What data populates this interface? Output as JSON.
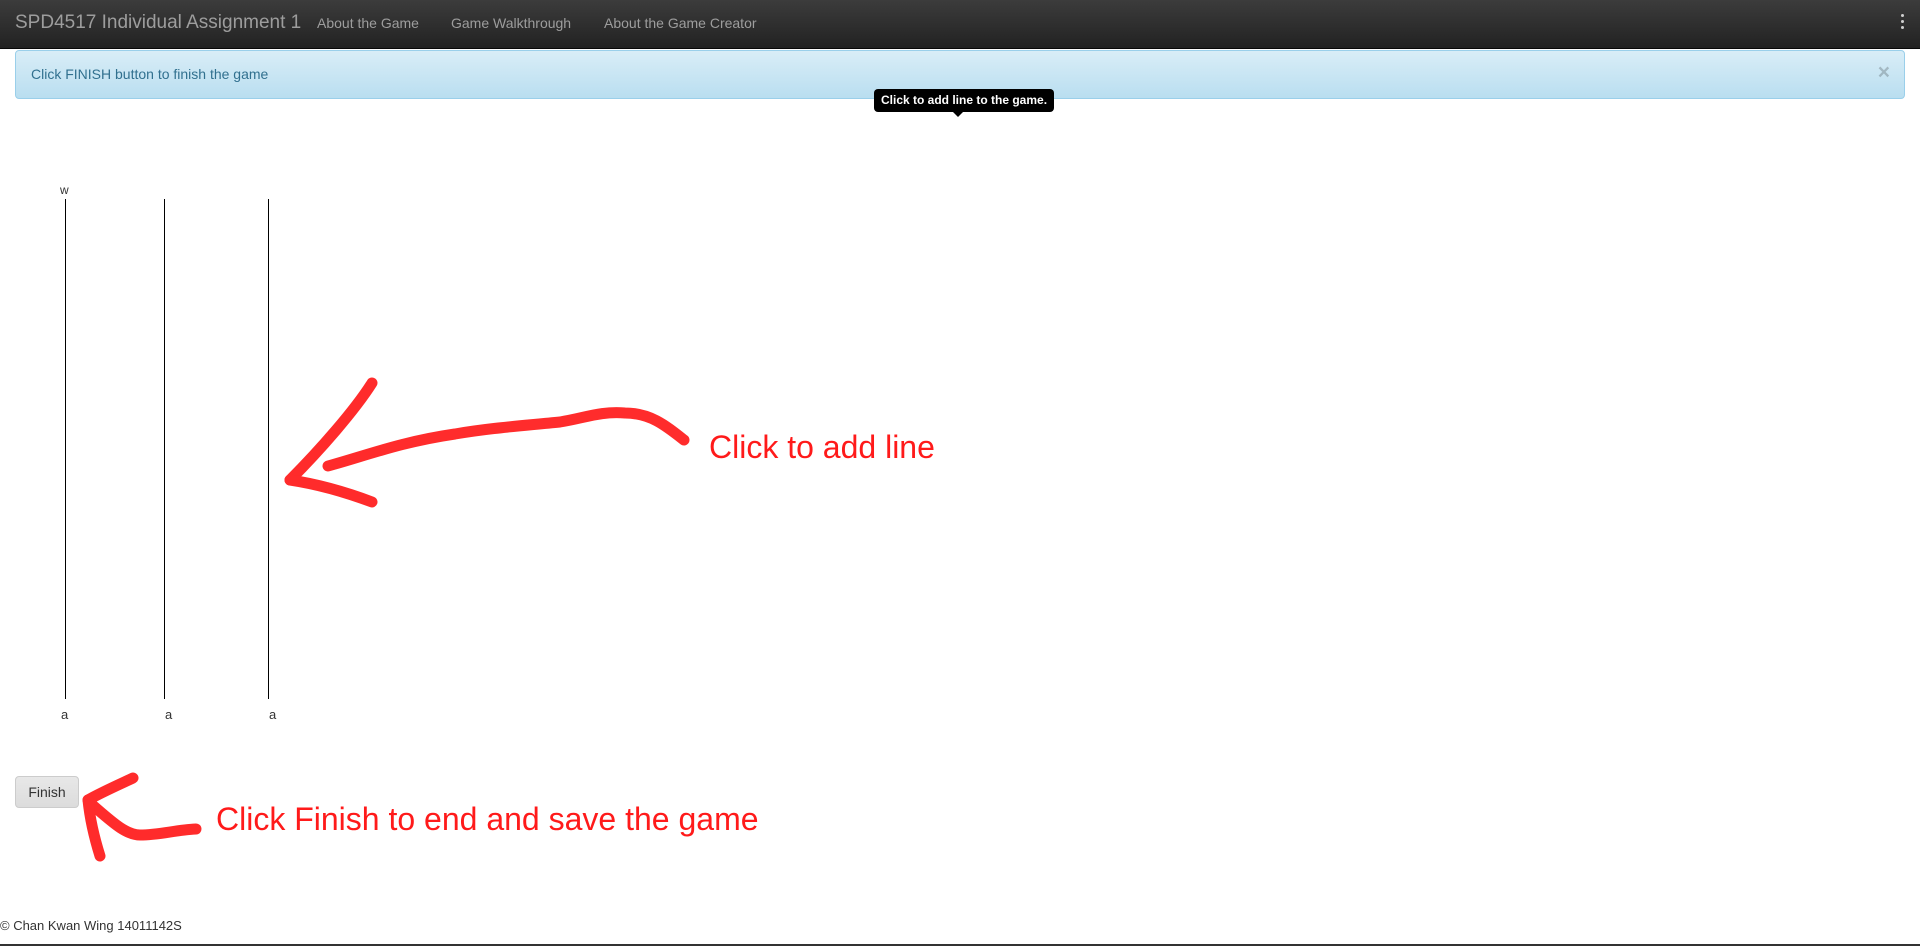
{
  "navbar": {
    "brand": "SPD4517 Individual Assignment 1",
    "links": [
      "About the Game",
      "Game Walkthrough",
      "About the Game Creator"
    ],
    "menu_icon": "kebab-menu-icon"
  },
  "alert": {
    "text": "Click FINISH button to finish the game",
    "close": "×"
  },
  "tooltip": {
    "text": "Click to add line to the game."
  },
  "game": {
    "top_labels": [
      "w"
    ],
    "bottom_labels": [
      "a",
      "a",
      "a"
    ]
  },
  "finish_button": {
    "label": "Finish"
  },
  "annotations": {
    "add_line": "Click to add line",
    "finish": "Click Finish to end and save the game",
    "color": "#ff1a1a"
  },
  "footer": {
    "text": "© Chan Kwan Wing 14011142S"
  }
}
